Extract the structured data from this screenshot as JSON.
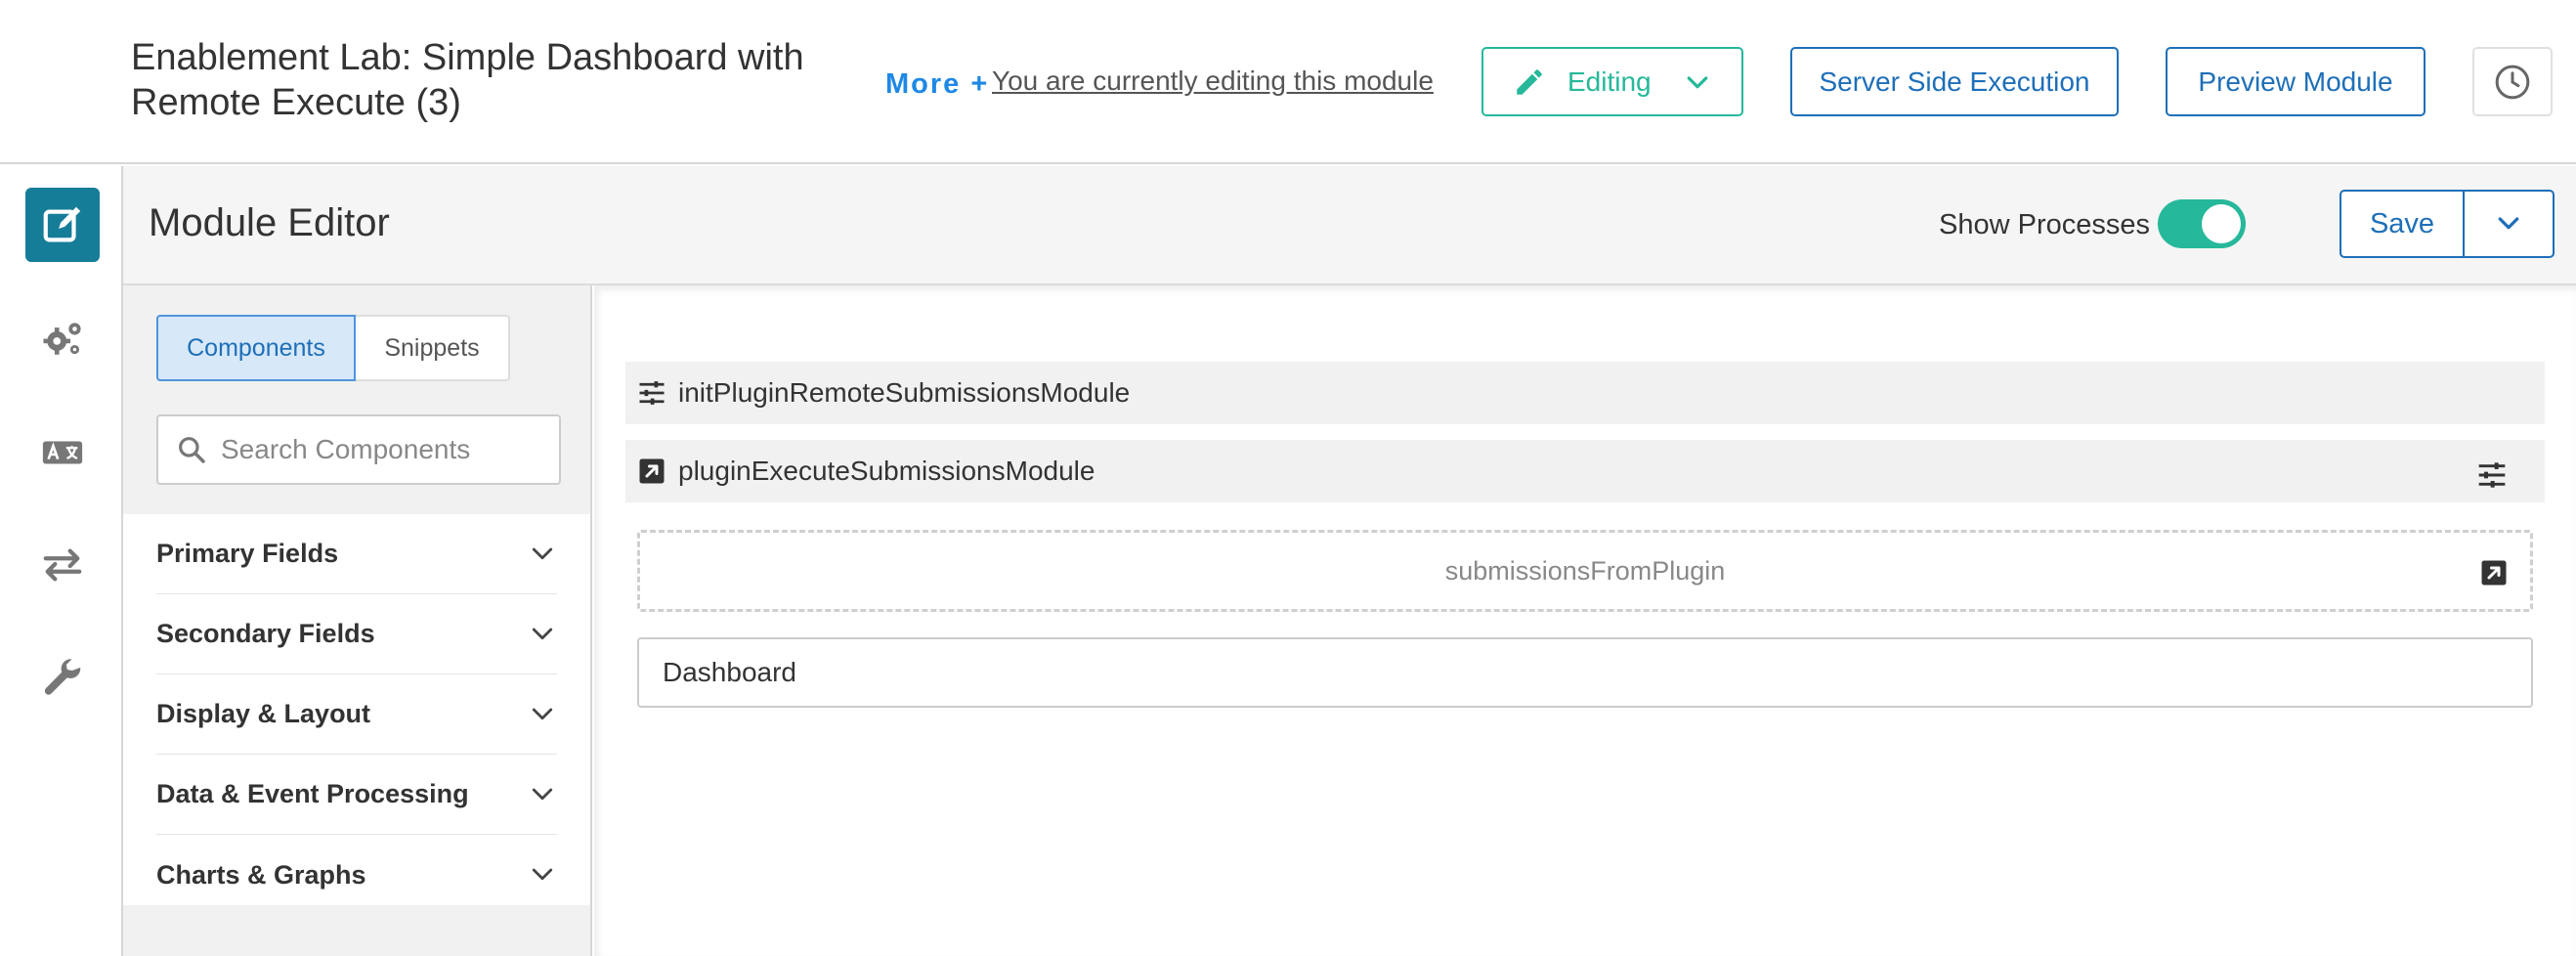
{
  "header": {
    "title": "Enablement Lab: Simple Dashboard with Remote Execute (3)",
    "more_label": "More +",
    "editing_note": "You are currently editing this module",
    "editing_label": "Editing",
    "server_side_label": "Server Side Execution",
    "preview_label": "Preview Module",
    "history_icon": "clock-icon"
  },
  "rail": {
    "items": [
      {
        "icon": "edit-icon",
        "active": true
      },
      {
        "icon": "gears-icon",
        "active": false
      },
      {
        "icon": "translate-icon",
        "active": false
      },
      {
        "icon": "swap-arrows-icon",
        "active": false
      },
      {
        "icon": "wrench-icon",
        "active": false
      }
    ]
  },
  "editor": {
    "title": "Module Editor",
    "show_processes_label": "Show Processes",
    "show_processes_on": true,
    "save_label": "Save"
  },
  "panel": {
    "tabs": [
      {
        "label": "Components",
        "active": true
      },
      {
        "label": "Snippets",
        "active": false
      }
    ],
    "search_placeholder": "Search Components",
    "categories": [
      {
        "label": "Primary Fields"
      },
      {
        "label": "Secondary Fields"
      },
      {
        "label": "Display & Layout"
      },
      {
        "label": "Data & Event Processing"
      },
      {
        "label": "Charts & Graphs"
      }
    ]
  },
  "canvas": {
    "init_process": "initPluginRemoteSubmissionsModule",
    "execute_process": "pluginExecuteSubmissionsModule",
    "drop_placeholder": "submissionsFromPlugin",
    "dashboard_label": "Dashboard"
  },
  "colors": {
    "accent_green": "#26b89a",
    "primary_blue": "#1e6fb8",
    "rail_active": "#167d99",
    "link_blue": "#1e88e5"
  }
}
